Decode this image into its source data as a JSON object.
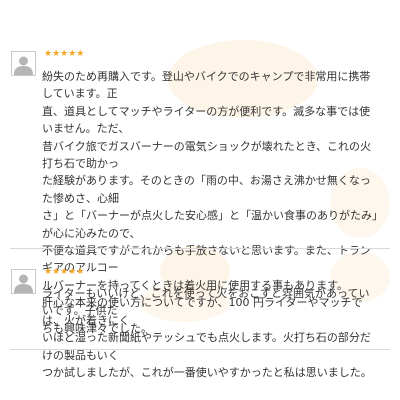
{
  "reviews": [
    {
      "rating": 5,
      "stars": "★★★★★",
      "text": "紛失のため再購入です。登山やバイクでのキャンプで非常用に携帯しています。正\n直、道具としてマッチやライターの方が便利です。滅多な事では使いません。ただ、\n昔バイク旅でガスバーナーの電気ショックが壊れたとき、これの火打ち石で助かっ\nた経験があります。そのときの「雨の中、お湯さえ沸かせ無くなった惨めさ、心細\nさ」と「バーナーが点火した安心感」と「温かい食事のありがたみ」が心に沁みたので、\n不便な道具ですがこれからも手放さないと思います。また、トランギアのアルコー\nルバーナーを持ってくときは着火用に使用する事もあります。\n 肝心な本来の使い方についてですが、100 円ライターやマッチでは、火が着きにく\nいほど湿った新聞紙やテッシュでも点火します。火打ち石の部分だけの製品もいく\nつか試しましたが、これが一番使いやすかったと私は思いました。"
    },
    {
      "rating": 5,
      "stars": "★★★★★",
      "text": "ライターもいいけど、これを使って火をおこすと雰囲気があっていいです。子供た\nちも興味津々でした。"
    }
  ],
  "colors": {
    "star": "#f5a623",
    "text": "#333333",
    "divider": "#d9d9d9",
    "cloud": "#fbecd6"
  },
  "icons": {
    "avatar": "user-silhouette-icon",
    "rating": "star-icon"
  }
}
